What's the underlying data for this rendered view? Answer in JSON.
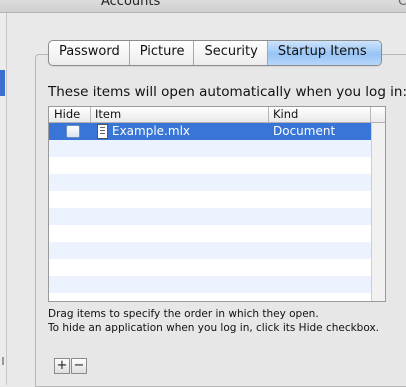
{
  "window": {
    "title": "Accounts",
    "right_fragment": "C"
  },
  "tabs": [
    "Password",
    "Picture",
    "Security",
    "Startup Items"
  ],
  "active_tab": "Startup Items",
  "intro_text": "These items will open automatically when you log in:",
  "table": {
    "columns": {
      "hide": "Hide",
      "item": "Item",
      "kind": "Kind"
    },
    "rows": [
      {
        "hidden": false,
        "icon": "document-icon",
        "item": "Example.mlx",
        "kind": "Document",
        "selected": true
      }
    ]
  },
  "help": {
    "line1": "Drag items to specify the order in which they open.",
    "line2": "To hide an application when you log in, click its Hide checkbox."
  },
  "buttons": {
    "add": "+",
    "remove": "−"
  },
  "colors": {
    "selection": "#3875d7",
    "tab_active": "#97c4f5",
    "stripe": "#edf3fe"
  }
}
